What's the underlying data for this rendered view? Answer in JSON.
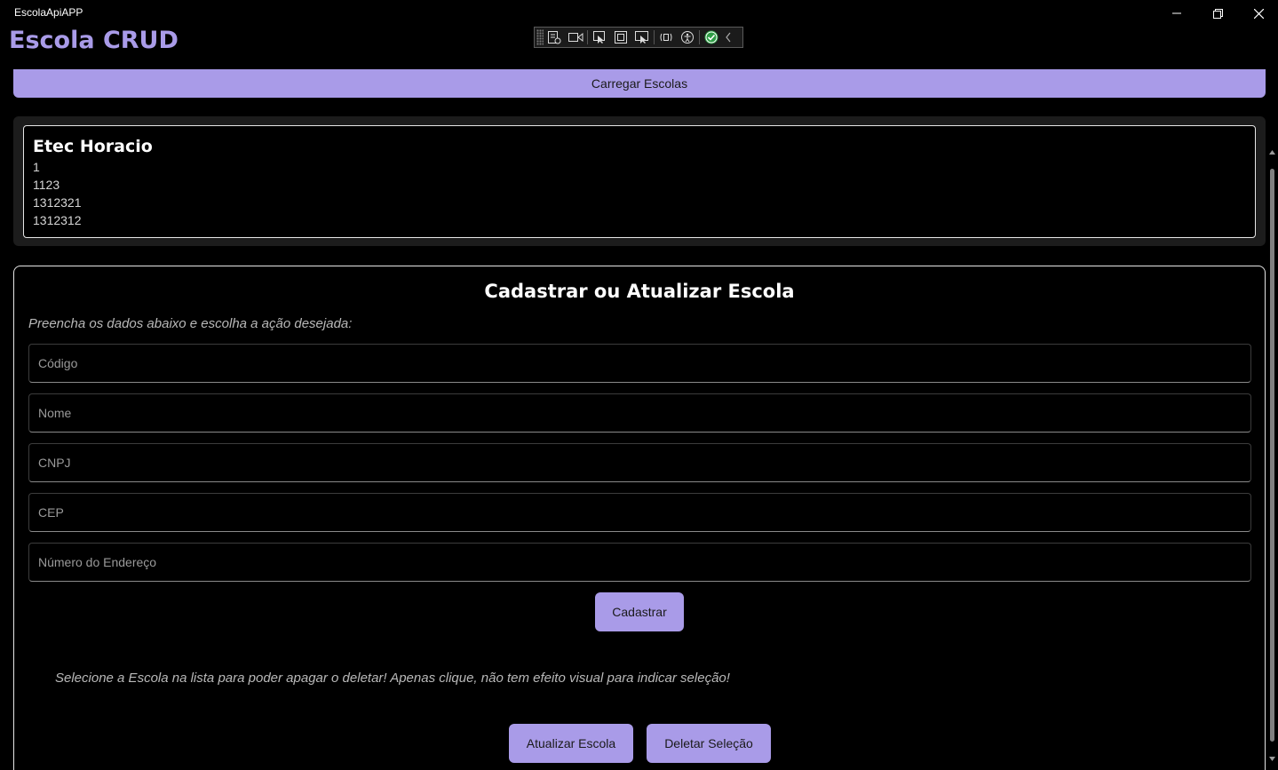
{
  "window": {
    "title": "EscolaApiAPP"
  },
  "header": {
    "title": "Escola CRUD"
  },
  "toolbar": {
    "load_label": "Carregar Escolas"
  },
  "school_list": [
    {
      "name": "Etec Horacio",
      "codigo": "1",
      "cnpj": "1123",
      "cep": "1312321",
      "numero": "1312312"
    }
  ],
  "form": {
    "title": "Cadastrar ou Atualizar Escola",
    "hint": "Preencha os dados abaixo e escolha a ação desejada:",
    "fields": {
      "codigo": {
        "placeholder": "Código",
        "value": ""
      },
      "nome": {
        "placeholder": "Nome",
        "value": ""
      },
      "cnpj": {
        "placeholder": "CNPJ",
        "value": ""
      },
      "cep": {
        "placeholder": "CEP",
        "value": ""
      },
      "numero": {
        "placeholder": "Número do Endereço",
        "value": ""
      }
    },
    "submit_label": "Cadastrar",
    "select_hint": "Selecione a Escola na lista para poder apagar o deletar! Apenas clique, não tem efeito visual para indicar seleção!",
    "update_label": "Atualizar Escola",
    "delete_label": "Deletar Seleção"
  },
  "colors": {
    "accent": "#a99be8",
    "background": "#000000",
    "panel": "#1c1c1c"
  },
  "debug_toolbar_icons": [
    "live-visual-tree-icon",
    "record-icon",
    "select-element-icon",
    "layout-adorners-icon",
    "track-focus-icon",
    "hot-reload-icon",
    "accessibility-icon",
    "checked-status-icon",
    "collapse-chevron-icon"
  ]
}
